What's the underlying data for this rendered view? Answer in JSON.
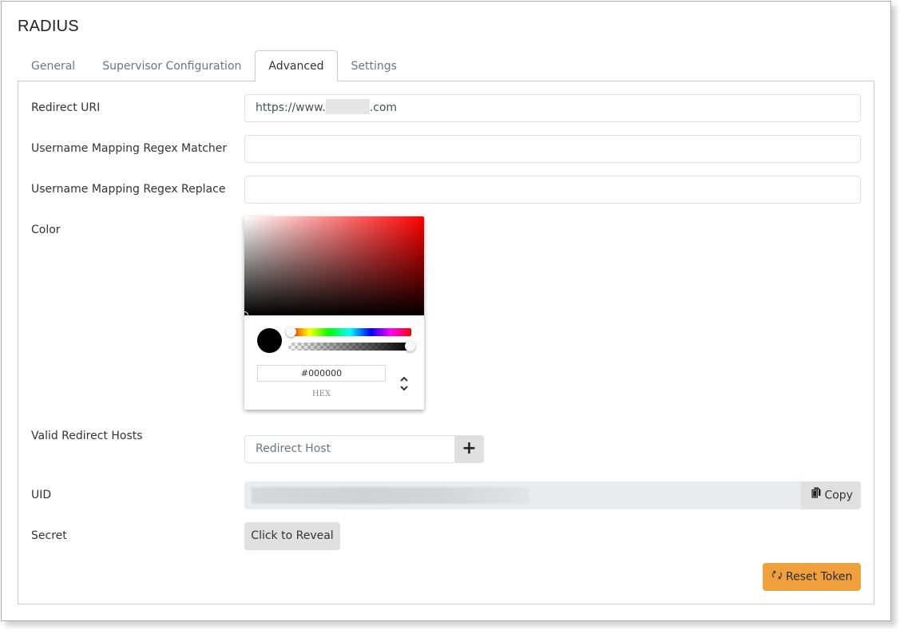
{
  "page": {
    "title": "RADIUS"
  },
  "tabs": [
    {
      "label": "General",
      "active": false
    },
    {
      "label": "Supervisor Configuration",
      "active": false
    },
    {
      "label": "Advanced",
      "active": true
    },
    {
      "label": "Settings",
      "active": false
    }
  ],
  "form": {
    "redirect_uri": {
      "label": "Redirect URI",
      "value_prefix": "https://www.",
      "value_suffix": ".com"
    },
    "regex_matcher": {
      "label": "Username Mapping Regex Matcher",
      "value": ""
    },
    "regex_replace": {
      "label": "Username Mapping Regex Replace",
      "value": ""
    },
    "color": {
      "label": "Color",
      "picker": {
        "hex_value": "#000000",
        "mode_label": "HEX",
        "selected_color": "#000000",
        "hue_base": "#ff0000",
        "alpha": 1.0,
        "hue": 0
      }
    },
    "valid_redirect_hosts": {
      "label": "Valid Redirect Hosts",
      "placeholder": "Redirect Host",
      "add_icon": "plus-icon"
    },
    "uid": {
      "label": "UID",
      "copy_label": "Copy",
      "copy_icon": "copy-icon"
    },
    "secret": {
      "label": "Secret",
      "reveal_label": "Click to Reveal"
    },
    "reset_token": {
      "label": "Reset Token",
      "icon": "refresh-icon",
      "color": "#f0a03c"
    }
  }
}
